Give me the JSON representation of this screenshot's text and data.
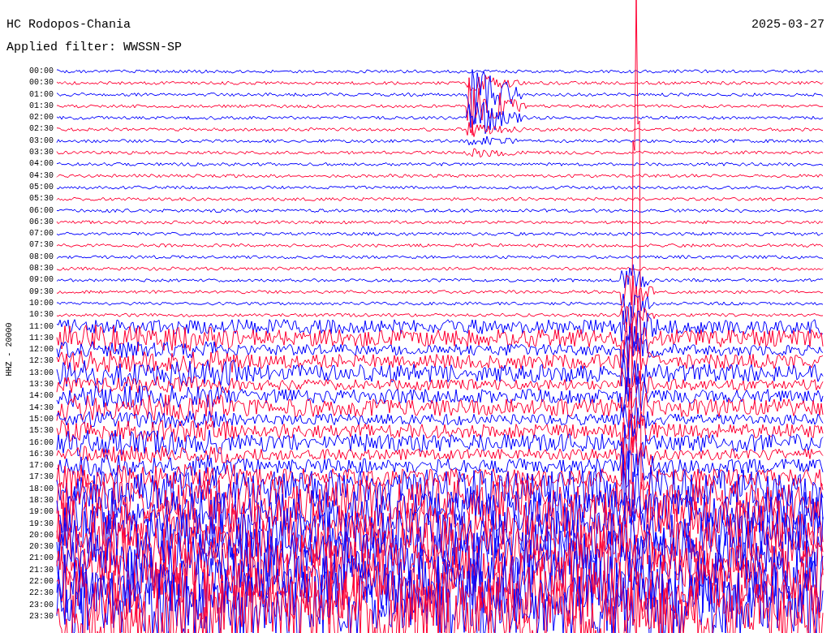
{
  "header": {
    "station": "HC Rodopos-Chania",
    "date": "2025-03-27",
    "filter": "Applied filter: WWSSN-SP"
  },
  "y_label": "HHZ - 20000",
  "rows": [
    {
      "time": "00:00",
      "color": "#0000ff"
    },
    {
      "time": "00:30",
      "color": "#ff0033"
    },
    {
      "time": "01:00",
      "color": "#0000ff"
    },
    {
      "time": "01:30",
      "color": "#ff0033"
    },
    {
      "time": "02:00",
      "color": "#0000ff"
    },
    {
      "time": "02:30",
      "color": "#ff0033"
    },
    {
      "time": "03:00",
      "color": "#0000ff"
    },
    {
      "time": "03:30",
      "color": "#ff0033"
    },
    {
      "time": "04:00",
      "color": "#0000ff"
    },
    {
      "time": "04:30",
      "color": "#ff0033"
    },
    {
      "time": "05:00",
      "color": "#0000ff"
    },
    {
      "time": "05:30",
      "color": "#ff0033"
    },
    {
      "time": "06:00",
      "color": "#0000ff"
    },
    {
      "time": "06:30",
      "color": "#ff0033"
    },
    {
      "time": "07:00",
      "color": "#0000ff"
    },
    {
      "time": "07:30",
      "color": "#ff0033"
    },
    {
      "time": "08:00",
      "color": "#0000ff"
    },
    {
      "time": "08:30",
      "color": "#ff0033"
    },
    {
      "time": "09:00",
      "color": "#0000ff"
    },
    {
      "time": "09:30",
      "color": "#ff0033"
    },
    {
      "time": "10:00",
      "color": "#0000ff"
    },
    {
      "time": "10:30",
      "color": "#ff0033"
    },
    {
      "time": "11:00",
      "color": "#0000ff"
    },
    {
      "time": "11:30",
      "color": "#ff0033"
    },
    {
      "time": "12:00",
      "color": "#0000ff"
    },
    {
      "time": "12:30",
      "color": "#ff0033"
    },
    {
      "time": "13:00",
      "color": "#0000ff"
    },
    {
      "time": "13:30",
      "color": "#ff0033"
    },
    {
      "time": "14:00",
      "color": "#0000ff"
    },
    {
      "time": "14:30",
      "color": "#ff0033"
    },
    {
      "time": "15:00",
      "color": "#0000ff"
    },
    {
      "time": "15:30",
      "color": "#ff0033"
    },
    {
      "time": "16:00",
      "color": "#0000ff"
    },
    {
      "time": "16:30",
      "color": "#ff0033"
    },
    {
      "time": "17:00",
      "color": "#0000ff"
    },
    {
      "time": "17:30",
      "color": "#ff0033"
    },
    {
      "time": "18:00",
      "color": "#0000ff"
    },
    {
      "time": "18:30",
      "color": "#ff0033"
    },
    {
      "time": "19:00",
      "color": "#0000ff"
    },
    {
      "time": "19:30",
      "color": "#ff0033"
    },
    {
      "time": "20:00",
      "color": "#0000ff"
    },
    {
      "time": "20:30",
      "color": "#ff0033"
    },
    {
      "time": "21:00",
      "color": "#0000ff"
    },
    {
      "time": "21:30",
      "color": "#ff0033"
    },
    {
      "time": "22:00",
      "color": "#0000ff"
    },
    {
      "time": "22:30",
      "color": "#ff0033"
    },
    {
      "time": "23:00",
      "color": "#0000ff"
    },
    {
      "time": "23:30",
      "color": "#ff0033"
    }
  ]
}
